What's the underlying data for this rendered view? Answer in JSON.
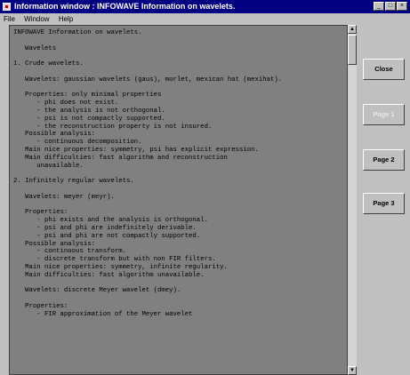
{
  "window": {
    "title": "Information window : INFOWAVE Information on wavelets."
  },
  "titlebar_buttons": [
    "_",
    "□",
    "×"
  ],
  "menu": [
    "File",
    "Window",
    "Help"
  ],
  "text_lines": [
    "INFOWAVE Information on wavelets.",
    "",
    "   Wavelets",
    "",
    "1. Crude wavelets.",
    "",
    "   Wavelets: gaussian wavelets (gaus), morlet, mexican hat (mexihat).",
    "",
    "   Properties: only minimal properties",
    "      - phi does not exist.",
    "      - the analysis is not orthogonal.",
    "      - psi is not compactly supported.",
    "      - the reconstruction property is not insured.",
    "   Possible analysis:",
    "      - continuous decomposition.",
    "   Main nice properties: symmetry, psi has explicit expression.",
    "   Main difficulties: fast algorithm and reconstruction",
    "      unavailable.",
    "",
    "2. Infinitely regular wavelets.",
    "",
    "   Wavelets: meyer (meyr).",
    "",
    "   Properties:",
    "      - phi exists and the analysis is orthogonal.",
    "      - psi and phi are indefinitely derivable.",
    "      - psi and phi are not compactly supported.",
    "   Possible analysis:",
    "      - continuous transform.",
    "      - discrete transform but with non FIR filters.",
    "   Main nice properties: symmetry, infinite regularity.",
    "   Main difficulties: fast algorithm unavailable.",
    "",
    "   Wavelets: discrete Meyer wavelet (dmey).",
    "",
    "   Properties:",
    "      - FIR approximation of the Meyer wavelet"
  ],
  "buttons": {
    "close": "Close",
    "page1": "Page 1",
    "page2": "Page 2",
    "page3": "Page 3"
  }
}
